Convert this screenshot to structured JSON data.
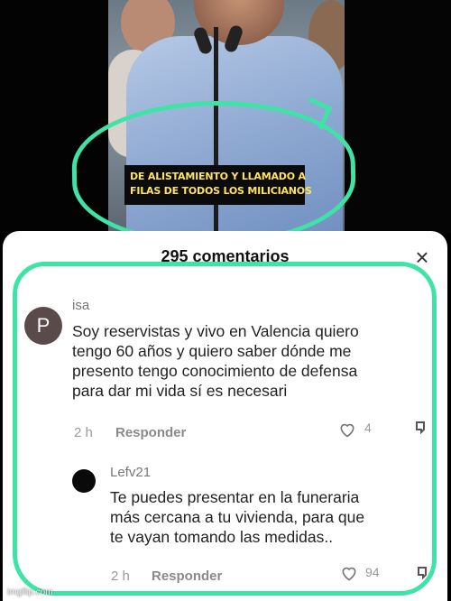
{
  "video": {
    "caption_lines": [
      "DE ALISTAMIENTO Y LLAMADO A",
      "FILAS DE TODOS LOS MILICIANOS"
    ]
  },
  "comments_panel": {
    "title": "295 comentarios",
    "close_icon": "close-icon"
  },
  "comments": [
    {
      "username": "isa",
      "avatar_letter": "P",
      "text_lines": [
        "Soy reservistas y vivo en Valencia quiero",
        "tengo 60 años y quiero saber dónde me",
        "presento tengo conocimiento de defensa",
        "para dar mi vida sí es necesari"
      ],
      "time": "2 h",
      "reply_label": "Responder",
      "likes": "4"
    },
    {
      "username": "Lefv21",
      "text_lines": [
        "Te puedes presentar en la funeraria",
        "más cercana a tu vivienda, para que",
        "te vayan tomando las medidas.."
      ],
      "time": "2 h",
      "reply_label": "Responder",
      "likes": "94"
    }
  ],
  "watermark": "imgflip.com",
  "colors": {
    "highlight": "#3fe3a6",
    "caption_text": "#ffe35c"
  }
}
